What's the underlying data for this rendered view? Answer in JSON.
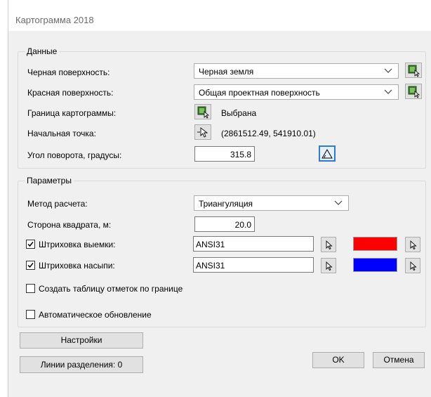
{
  "window": {
    "title": "Картограмма 2018"
  },
  "data_group": {
    "legend": "Данные",
    "black_surface": {
      "label": "Черная поверхность:",
      "value": "Черная земля"
    },
    "red_surface": {
      "label": "Красная поверхность:",
      "value": "Общая проектная поверхность"
    },
    "boundary": {
      "label": "Граница картограммы:",
      "status": "Выбрана"
    },
    "start_point": {
      "label": "Начальная точка:",
      "coords": "(2861512.49, 541910.01)"
    },
    "rotation": {
      "label": "Угол поворота, градусы:",
      "value": "315.8"
    }
  },
  "params_group": {
    "legend": "Параметры",
    "method": {
      "label": "Метод расчета:",
      "value": "Триангуляция"
    },
    "square_side": {
      "label": "Сторона квадрата, м:",
      "value": "20.0"
    },
    "cut_hatch": {
      "label": "Штриховка выемки:",
      "value": "ANSI31",
      "checked": true,
      "color": "#ff0000"
    },
    "fill_hatch": {
      "label": "Штриховка насыпи:",
      "value": "ANSI31",
      "checked": true,
      "color": "#0000ff"
    },
    "create_table": {
      "label": "Создать таблицу отметок по границе",
      "checked": false
    },
    "auto_update": {
      "label": "Автоматическое обновление",
      "checked": false
    }
  },
  "buttons": {
    "settings": "Настройки",
    "split_lines": "Линии разделения: 0",
    "ok": "OK",
    "cancel": "Отмена"
  },
  "icons": {
    "surface_pick": "select-object-icon",
    "point_pick": "cursor-pick-icon",
    "angle_pick": "angle-icon",
    "dropdown": "chevron-down-icon",
    "checked": "checkmark-icon"
  }
}
